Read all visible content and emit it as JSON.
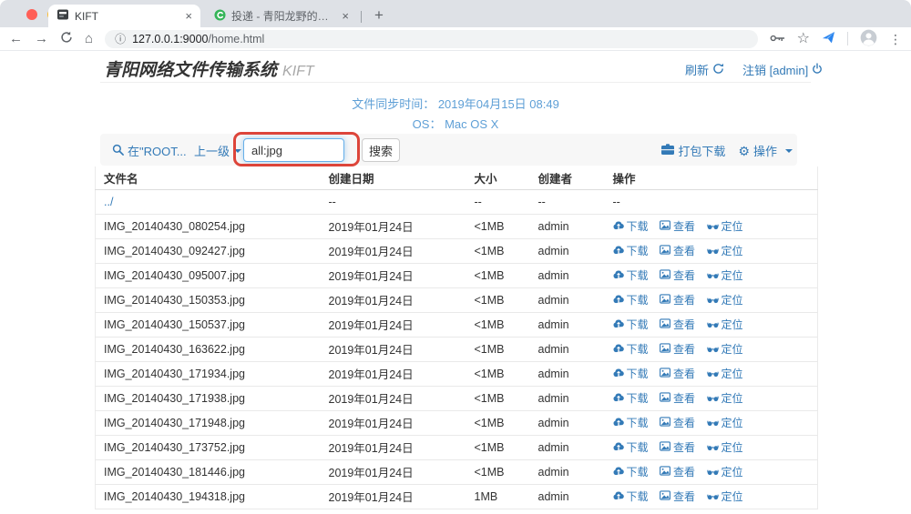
{
  "browser": {
    "tabs": [
      {
        "title": "KIFT"
      },
      {
        "title": "投递 - 青阳龙野的个人空间 - 开"
      }
    ],
    "url_host": "127.0.0.1:9000",
    "url_path": "/home.html",
    "icons": {
      "close": "×",
      "new_tab": "+",
      "back": "←",
      "forward": "→",
      "home": "⌂",
      "info": "ⓘ",
      "star": "☆",
      "menu_dots": "⋮",
      "gear": "⚙"
    }
  },
  "header": {
    "title_cn": "青阳网络文件传输系统",
    "title_en": "KIFT",
    "refresh_label": "刷新",
    "logout_label": "注销 [admin]"
  },
  "status": {
    "sync_label": "文件同步时间：",
    "sync_value": "2019年04月15日 08:49",
    "os_label": "OS：",
    "os_value": "Mac OS X"
  },
  "toolbar": {
    "search_scope": "在\"ROOT...",
    "parent_label": "上一级",
    "search_value": "all:jpg",
    "search_button": "搜索",
    "package_download_label": "打包下载",
    "operations_label": "操作"
  },
  "colors": {
    "link_blue": "#337ab7",
    "status_blue": "#5e9fd6",
    "annotation_red": "#dd453a"
  },
  "table": {
    "headers": [
      "文件名",
      "创建日期",
      "大小",
      "创建者",
      "操作"
    ],
    "parent_row": {
      "name": "../",
      "date": "--",
      "size": "--",
      "creator": "--",
      "ops": "--"
    },
    "actions": {
      "download": "下载",
      "view": "查看",
      "locate": "定位"
    },
    "rows": [
      {
        "name": "IMG_20140430_080254.jpg",
        "date": "2019年01月24日",
        "size": "<1MB",
        "creator": "admin"
      },
      {
        "name": "IMG_20140430_092427.jpg",
        "date": "2019年01月24日",
        "size": "<1MB",
        "creator": "admin"
      },
      {
        "name": "IMG_20140430_095007.jpg",
        "date": "2019年01月24日",
        "size": "<1MB",
        "creator": "admin"
      },
      {
        "name": "IMG_20140430_150353.jpg",
        "date": "2019年01月24日",
        "size": "<1MB",
        "creator": "admin"
      },
      {
        "name": "IMG_20140430_150537.jpg",
        "date": "2019年01月24日",
        "size": "<1MB",
        "creator": "admin"
      },
      {
        "name": "IMG_20140430_163622.jpg",
        "date": "2019年01月24日",
        "size": "<1MB",
        "creator": "admin"
      },
      {
        "name": "IMG_20140430_171934.jpg",
        "date": "2019年01月24日",
        "size": "<1MB",
        "creator": "admin"
      },
      {
        "name": "IMG_20140430_171938.jpg",
        "date": "2019年01月24日",
        "size": "<1MB",
        "creator": "admin"
      },
      {
        "name": "IMG_20140430_171948.jpg",
        "date": "2019年01月24日",
        "size": "<1MB",
        "creator": "admin"
      },
      {
        "name": "IMG_20140430_173752.jpg",
        "date": "2019年01月24日",
        "size": "<1MB",
        "creator": "admin"
      },
      {
        "name": "IMG_20140430_181446.jpg",
        "date": "2019年01月24日",
        "size": "<1MB",
        "creator": "admin"
      },
      {
        "name": "IMG_20140430_194318.jpg",
        "date": "2019年01月24日",
        "size": "1MB",
        "creator": "admin"
      }
    ]
  }
}
